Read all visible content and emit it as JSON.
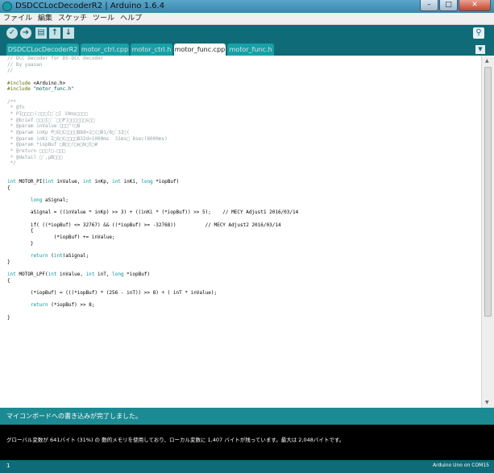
{
  "window": {
    "title": "DSDCCLocDecoderR2 | Arduino 1.6.4"
  },
  "menu": [
    "ファイル",
    "編集",
    "スケッチ",
    "ツール",
    "ヘルプ"
  ],
  "toolbar": {
    "verify_icon": "✓",
    "upload_icon": "➜",
    "new_icon": "▤",
    "open_icon": "↑",
    "save_icon": "↓",
    "serial_icon": "⚲"
  },
  "tabs": [
    "DSDCCLocDecoderR2",
    "motor_ctrl.cpp",
    "motor_ctrl.h",
    "motor_func.cpp",
    "motor_func.h"
  ],
  "editor": {
    "lines": [
      "// DCC Decoder for DS-DCC decoder",
      "// By yaasan",
      "//",
      "",
      "#include <Arduino.h>",
      "#include \"motor_func.h\"",
      "",
      "/**",
      " * @fn",
      " * PI□□□□ｉ□□□[□`□] 10ms□□□□",
      " * @brief □□□[□``□□P]□□□□□□s□□",
      " * @param inValue □□□^!□B",
      " * @param inKp P□G□C□□□□B8d=1□(□B1/8□`32□(",
      " * @param inKi I□G□C□□□□B32d=1000ms  31ms□`8sec(8000ms)",
      " * @param *iopBuf □B□□!□e□b□t□#",
      " * @return □□□!□-□□□",
      " * @detail □`,μB□□□",
      " */",
      "",
      "",
      "int MOTOR_PI(int inValue, int inKp, int inKi, long *iopBuf)",
      "{",
      "",
      "        long aSignal;",
      "",
      "        aSignal = ((inValue * inKp) >> 3) + ((inKi * (*iopBuf)) >> 5);    // MECY Adjust1 2016/03/14",
      "",
      "        if( ((*iopBuf) <= 32767) && ((*iopBuf) >= -32768))          // MECY Adjust2 2016/03/14",
      "        {",
      "                (*iopBuf) += inValue;",
      "        }",
      "",
      "        return (int)aSignal;",
      "}",
      "",
      "int MOTOR_LPF(int inValue, int inT, long *iopBuf)",
      "{",
      "",
      "        (*iopBuf) = (((*iopBuf) * (256 - inT)) >> 8) + ( inT * inValue);",
      "",
      "        return (*iopBuf) >> 8;",
      "",
      "}"
    ]
  },
  "status": {
    "message": "マイコンボードへの書き込みが完了しました。"
  },
  "console": {
    "message": "グローバル変数が 641バイト (31%) の 動的メモリを使用しており、ローカル変数に 1,407 バイトが残っています。最大は 2,048バイトです。"
  },
  "footer": {
    "line_number": "1",
    "board": "Arduino Uno on COM15"
  },
  "colors": {
    "accent_teal": "#0f6b78",
    "tab_teal": "#17a1a5",
    "status_teal": "#1c8a92"
  }
}
